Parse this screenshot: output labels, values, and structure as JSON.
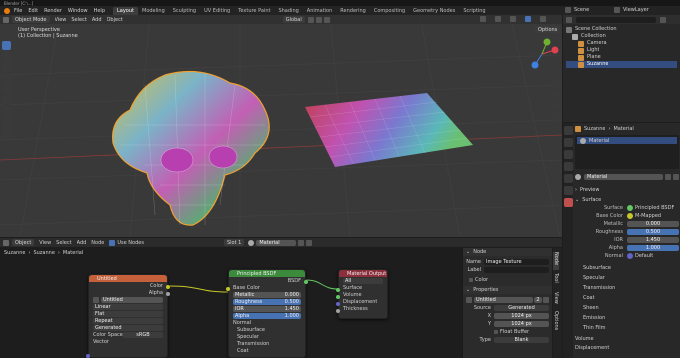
{
  "titlebar": {
    "title": "Blender [C:\\...]"
  },
  "menu": {
    "items": [
      "File",
      "Edit",
      "Render",
      "Window",
      "Help"
    ],
    "workspaces": [
      "Layout",
      "Modeling",
      "Sculpting",
      "UV Editing",
      "Texture Paint",
      "Shading",
      "Animation",
      "Rendering",
      "Compositing",
      "Geometry Nodes",
      "Scripting"
    ],
    "active_workspace": "Layout",
    "scene": "Scene",
    "view_layer": "ViewLayer"
  },
  "viewport": {
    "mode": "Object Mode",
    "menus": [
      "View",
      "Select",
      "Add",
      "Object"
    ],
    "orientation": "Global",
    "overlay_title": "User Perspective",
    "overlay_sub": "(1) Collection | Suzanne",
    "options": "Options"
  },
  "outliner": {
    "root": "Scene Collection",
    "items": [
      {
        "label": "Collection"
      },
      {
        "label": "Camera"
      },
      {
        "label": "Light"
      },
      {
        "label": "Plane"
      },
      {
        "label": "Suzanne"
      }
    ]
  },
  "properties": {
    "breadcrumb": [
      "Suzanne",
      "Material"
    ],
    "slot": "Material",
    "material_name": "Material",
    "sections": {
      "preview": "Preview",
      "surface": "Surface"
    },
    "surface_shader": "Principled BSDF",
    "rows": [
      {
        "label": "Surface",
        "value": "Principled BSDF"
      },
      {
        "label": "Base Color",
        "value": "M-Mapped"
      },
      {
        "label": "Metallic",
        "value": "0.000"
      },
      {
        "label": "Roughness",
        "value": "0.500"
      },
      {
        "label": "IOR",
        "value": "1.450"
      },
      {
        "label": "Alpha",
        "value": "1.000"
      },
      {
        "label": "Normal",
        "value": "Default"
      }
    ],
    "collapsed": [
      "Subsurface",
      "Specular",
      "Transmission",
      "Coat",
      "Sheen",
      "Emission",
      "Thin Film",
      "Volume",
      "Displacement"
    ]
  },
  "node_editor": {
    "header": [
      "Object",
      "View",
      "Select",
      "Add",
      "Node"
    ],
    "use_nodes": "Use Nodes",
    "slot": "Slot 1",
    "material": "Material",
    "breadcrumb": [
      "Suzanne",
      "Suzanne",
      "Material"
    ],
    "image_node": {
      "title": "Untitled",
      "outputs": [
        "Color",
        "Alpha"
      ],
      "image": "Untitled",
      "interp": "Linear",
      "proj": "Flat",
      "ext": "Repeat",
      "source": "Generated",
      "cs_label": "Color Space",
      "color_space": "sRGB",
      "vector": "Vector"
    },
    "bsdf_node": {
      "title": "Principled BSDF",
      "output": "BSDF",
      "rows": [
        {
          "label": "Base Color",
          "value": ""
        },
        {
          "label": "Metallic",
          "value": "0.000"
        },
        {
          "label": "Roughness",
          "value": "0.500"
        },
        {
          "label": "IOR",
          "value": "1.450"
        },
        {
          "label": "Alpha",
          "value": "1.000"
        }
      ],
      "extras": [
        "Normal",
        "Subsurface",
        "Specular",
        "Transmission",
        "Coat"
      ]
    },
    "output_node": {
      "title": "Material Output",
      "target": "All",
      "inputs": [
        "Surface",
        "Volume",
        "Displacement",
        "Thickness"
      ]
    }
  },
  "sidebar": {
    "tabs": [
      "Node",
      "Tool",
      "View",
      "Options"
    ],
    "node_title": "Node",
    "name_label": "Name",
    "name_value": "Image Texture",
    "label_label": "Label",
    "color": "Color",
    "properties": "Properties",
    "image": "Untitled",
    "users": "2",
    "source_label": "Source",
    "source": "Generated",
    "x": "1024 px",
    "y": "1024 px",
    "float_buffer": "Float Buffer",
    "type_label": "Type",
    "type": "Blank"
  },
  "colors": {
    "accent": "#4772b3",
    "header_texture": "#c5603b",
    "header_shader": "#3c8a3b",
    "header_output": "#8c2f3c",
    "socket_color": "#c7c729",
    "socket_float": "#a1a1a1",
    "socket_shader": "#63c763"
  }
}
